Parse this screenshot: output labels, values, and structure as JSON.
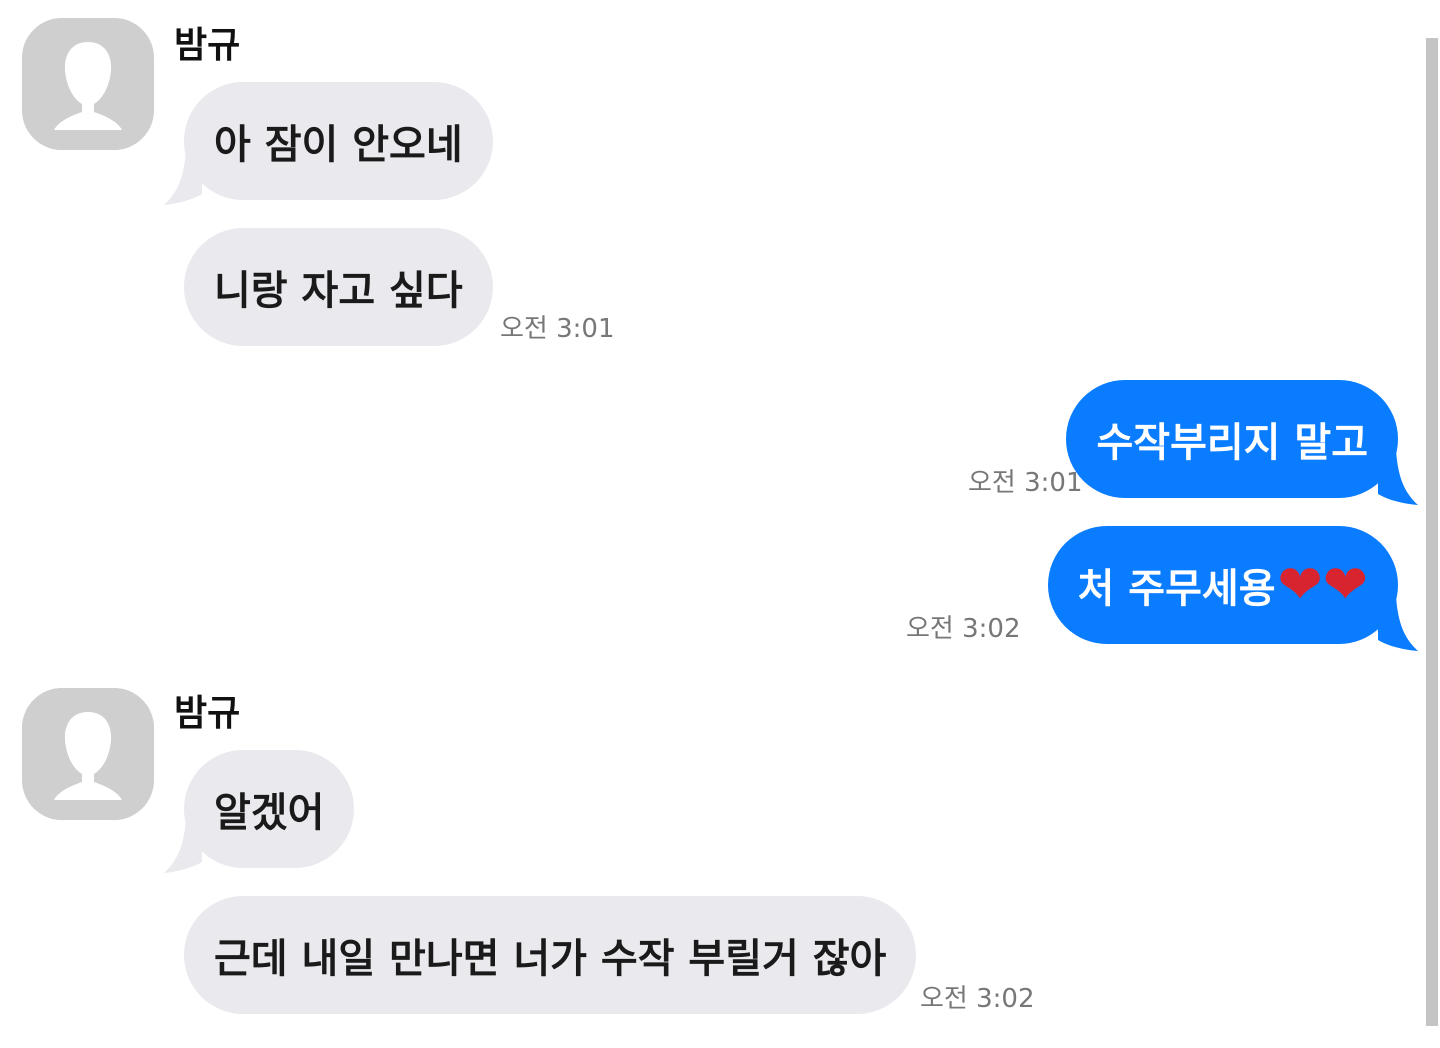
{
  "messages": [
    {
      "sender": "밤규",
      "text": "아 잠이 안오네"
    },
    {
      "text": "니랑 자고 싶다",
      "time": "오전 3:01"
    },
    {
      "text": "수작부리지 말고",
      "time": "오전 3:01"
    },
    {
      "text": "처 주무세용",
      "emoji": "❤❤",
      "time": "오전 3:02"
    },
    {
      "sender": "밤규",
      "text": "알겠어"
    },
    {
      "text": "근데 내일 만나면 너가 수작 부릴거 잖아",
      "time": "오전 3:02"
    }
  ],
  "colors": {
    "incoming_bubble": "#e9e9ee",
    "outgoing_bubble": "#0a7cff",
    "avatar": "#cfcfcf",
    "timestamp": "#777777"
  },
  "icons": {
    "avatar": "person-silhouette-icon",
    "heart": "red-heart-emoji"
  }
}
